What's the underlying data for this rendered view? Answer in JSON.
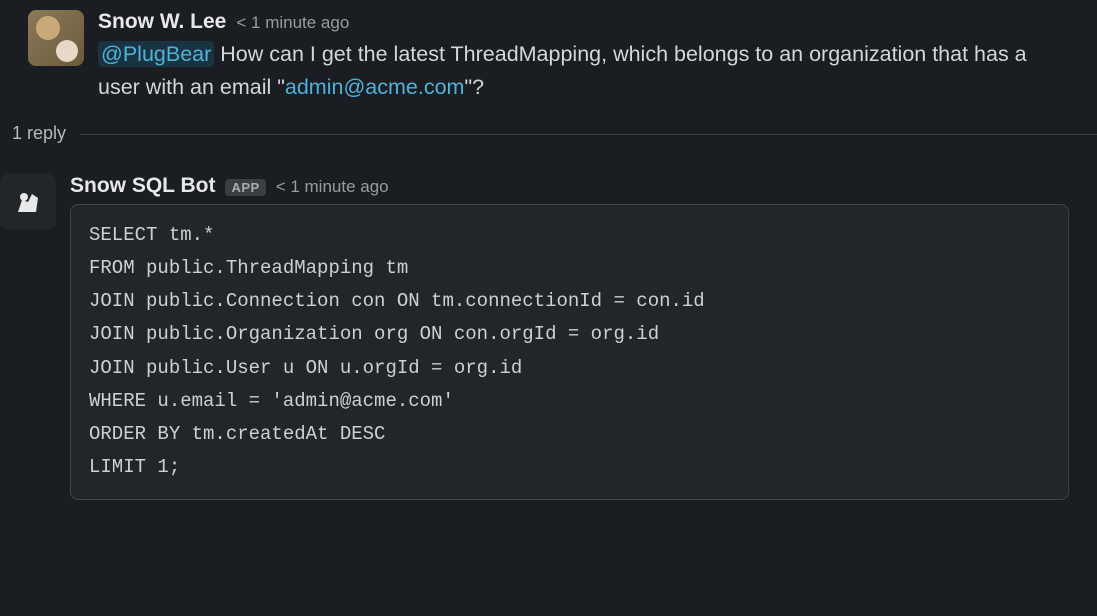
{
  "messages": {
    "original": {
      "author": "Snow W. Lee",
      "timestamp": "< 1 minute ago",
      "mention": "@PlugBear",
      "text_before": "How can I get the latest ThreadMapping, which belongs to an organization that has a user with an email \"",
      "email_link": "admin@acme.com",
      "text_after": "\"?"
    },
    "reply_count": "1 reply",
    "reply": {
      "author": "Snow SQL Bot",
      "app_badge": "APP",
      "timestamp": "< 1 minute ago",
      "code": "SELECT tm.*\nFROM public.ThreadMapping tm\nJOIN public.Connection con ON tm.connectionId = con.id\nJOIN public.Organization org ON con.orgId = org.id\nJOIN public.User u ON u.orgId = org.id\nWHERE u.email = 'admin@acme.com'\nORDER BY tm.createdAt DESC\nLIMIT 1;"
    }
  }
}
